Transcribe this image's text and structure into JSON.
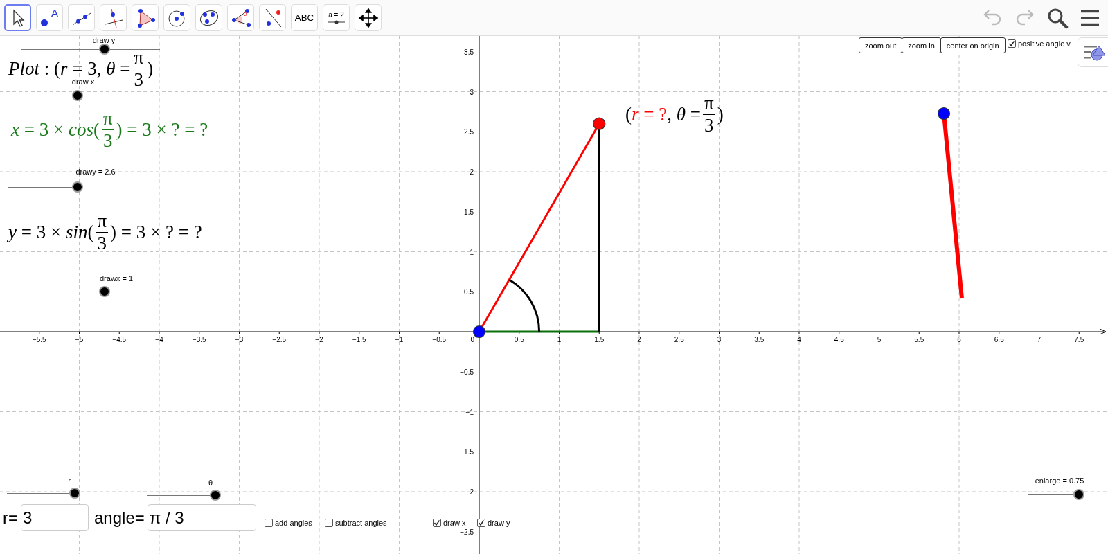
{
  "toolbar": {
    "tools": [
      {
        "kind": "move",
        "selected": true
      },
      {
        "kind": "point",
        "label": "A",
        "selected": false
      },
      {
        "kind": "line",
        "selected": false
      },
      {
        "kind": "perpendicular",
        "selected": false
      },
      {
        "kind": "polygon",
        "selected": false
      },
      {
        "kind": "circle",
        "selected": false
      },
      {
        "kind": "conic",
        "selected": false
      },
      {
        "kind": "angle",
        "label": "α",
        "selected": false
      },
      {
        "kind": "reflect",
        "selected": false
      },
      {
        "kind": "text",
        "label": "ABC",
        "selected": false
      },
      {
        "kind": "slider",
        "label": "a = 2",
        "selected": false
      },
      {
        "kind": "move-view",
        "selected": false
      }
    ],
    "actions": [
      {
        "kind": "undo",
        "disabled": true
      },
      {
        "kind": "redo",
        "disabled": true
      },
      {
        "kind": "search",
        "disabled": false
      },
      {
        "kind": "menu",
        "disabled": false
      }
    ]
  },
  "graphics": {
    "x_axis": {
      "tick_labels": [
        "−5.5",
        "−5",
        "−4.5",
        "−4",
        "−3.5",
        "−3",
        "−2.5",
        "−2",
        "−1.5",
        "−1",
        "−0.5",
        "0.5",
        "1",
        "1.5",
        "2",
        "2.5",
        "3",
        "3.5",
        "4",
        "4.5",
        "5",
        "5.5",
        "6",
        "6.5",
        "7",
        "7.5"
      ]
    },
    "y_axis": {
      "tick_labels": [
        "3.5",
        "3",
        "2.5",
        "2",
        "1.5",
        "1",
        "0.5",
        "−0.5",
        "−1",
        "−1.5",
        "−2",
        "−2.5"
      ]
    },
    "origin_label": "0",
    "sliders": [
      {
        "label": "draw y",
        "level": 0.6
      },
      {
        "label": "draw x",
        "level": 1
      },
      {
        "label": "drawy = 2.6",
        "level": 1
      },
      {
        "label": "drawx = 1",
        "level": 0.6
      },
      {
        "label": "r",
        "level": 1
      },
      {
        "label": "θ",
        "level": 1
      },
      {
        "label": "enlarge = 0.75",
        "level": 0.96
      }
    ],
    "formulas": [
      {
        "color": "#000000",
        "parts": [
          {
            "text": "*Plot* : (*r* = 3, *θ* = "
          },
          {
            "num": "π",
            "den": "3"
          },
          {
            "text": ")"
          }
        ]
      },
      {
        "color": "#1a7a1a",
        "parts": [
          {
            "text": "*x* = 3 × *cos*("
          },
          {
            "num": "π",
            "den": "3"
          },
          {
            "text": ") = 3 × ? = ?"
          }
        ]
      },
      {
        "color": "#000000",
        "parts": [
          {
            "text": "*y* = 3 × *sin*("
          },
          {
            "num": "π",
            "den": "3"
          },
          {
            "text": ") = 3 × ? = ?"
          }
        ]
      },
      {
        "color": "#000000",
        "parts": [
          {
            "text": "("
          },
          {
            "text": "*r* = ?",
            "color": "#ff0000"
          },
          {
            "text": ", *θ* = "
          },
          {
            "num": "π",
            "den": "3"
          },
          {
            "text": ")"
          }
        ]
      }
    ],
    "buttons": [
      "zoom out",
      "zoom in",
      "center on origin"
    ],
    "inputs": [
      {
        "label": "r=",
        "value": "3"
      },
      {
        "label": "angle=",
        "value": "π / 3"
      }
    ],
    "checkboxes": [
      {
        "label": "positive angle v",
        "checked": true
      },
      {
        "label": "add angles",
        "checked": false
      },
      {
        "label": "subtract angles",
        "checked": false
      },
      {
        "label": "draw x",
        "checked": true
      },
      {
        "label": "draw y",
        "checked": true
      }
    ]
  }
}
